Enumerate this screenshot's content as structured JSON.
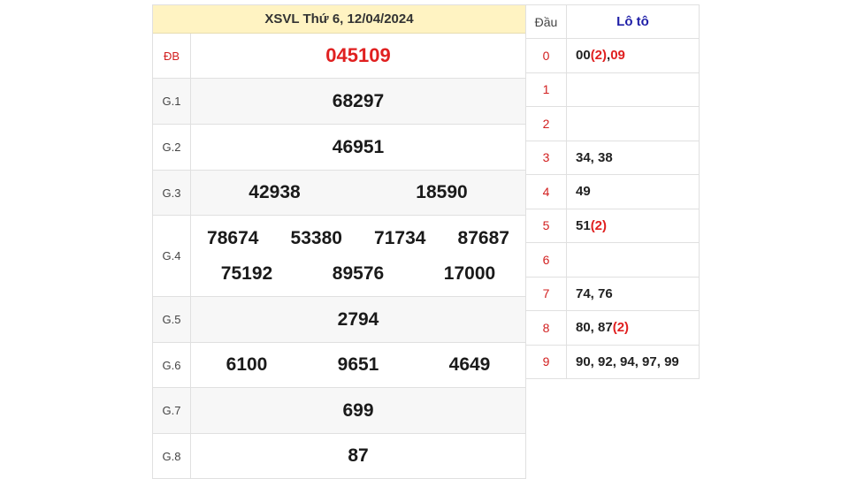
{
  "header": {
    "title": "XSVL Thứ 6, 12/04/2024"
  },
  "prizes": [
    {
      "label": "ĐB",
      "lines": [
        [
          "045109"
        ]
      ],
      "special": true
    },
    {
      "label": "G.1",
      "lines": [
        [
          "68297"
        ]
      ]
    },
    {
      "label": "G.2",
      "lines": [
        [
          "46951"
        ]
      ]
    },
    {
      "label": "G.3",
      "lines": [
        [
          "42938",
          "18590"
        ]
      ]
    },
    {
      "label": "G.4",
      "lines": [
        [
          "78674",
          "53380",
          "71734",
          "87687"
        ],
        [
          "75192",
          "89576",
          "17000"
        ]
      ]
    },
    {
      "label": "G.5",
      "lines": [
        [
          "2794"
        ]
      ]
    },
    {
      "label": "G.6",
      "lines": [
        [
          "6100",
          "9651",
          "4649"
        ]
      ]
    },
    {
      "label": "G.7",
      "lines": [
        [
          "699"
        ]
      ]
    },
    {
      "label": "G.8",
      "lines": [
        [
          "87"
        ]
      ]
    }
  ],
  "loto": {
    "head_col": "Đầu",
    "loto_col": "Lô tô",
    "rows": [
      {
        "dau": "0",
        "parts": [
          {
            "t": "00"
          },
          {
            "t": "(2)",
            "red": true
          },
          {
            "t": ", "
          },
          {
            "t": "09",
            "red": true
          }
        ]
      },
      {
        "dau": "1",
        "parts": []
      },
      {
        "dau": "2",
        "parts": []
      },
      {
        "dau": "3",
        "parts": [
          {
            "t": "34, 38"
          }
        ]
      },
      {
        "dau": "4",
        "parts": [
          {
            "t": "49"
          }
        ]
      },
      {
        "dau": "5",
        "parts": [
          {
            "t": "51"
          },
          {
            "t": "(2)",
            "red": true
          }
        ]
      },
      {
        "dau": "6",
        "parts": []
      },
      {
        "dau": "7",
        "parts": [
          {
            "t": "74, 76"
          }
        ]
      },
      {
        "dau": "8",
        "parts": [
          {
            "t": "80, 87"
          },
          {
            "t": "(2)",
            "red": true
          }
        ]
      },
      {
        "dau": "9",
        "parts": [
          {
            "t": "90, 92, 94, 97, 99"
          }
        ]
      }
    ]
  }
}
